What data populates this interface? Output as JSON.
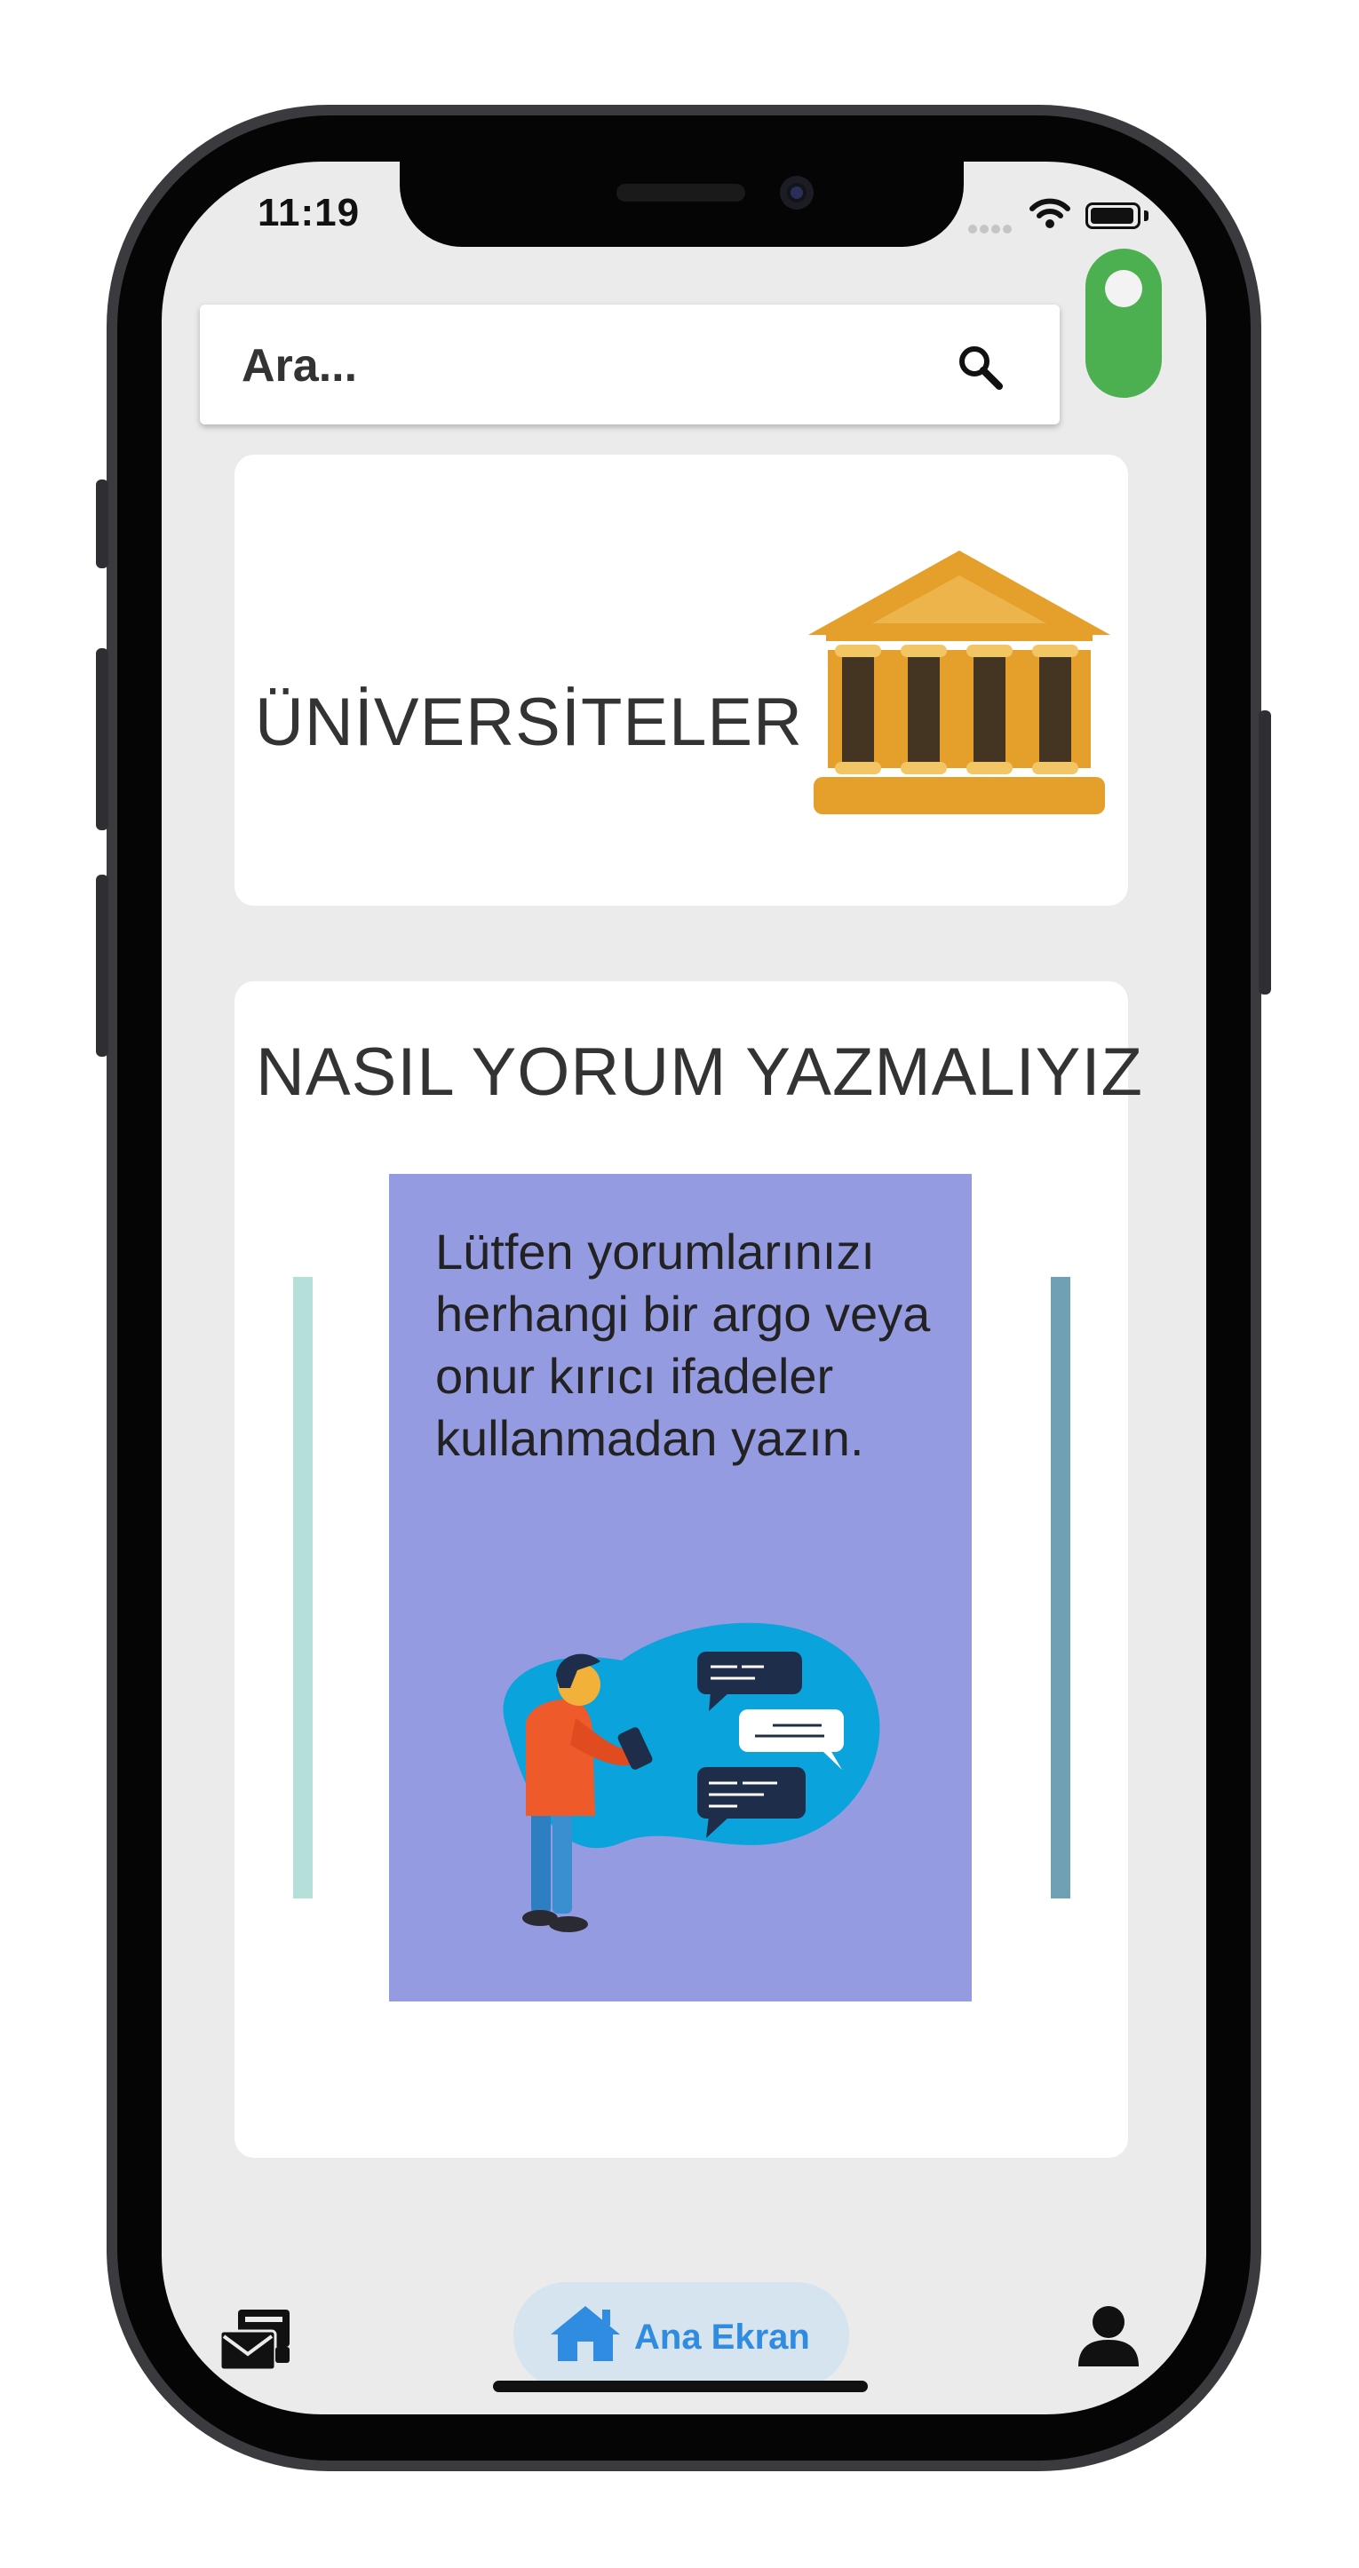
{
  "status_bar": {
    "time": "11:19"
  },
  "search": {
    "placeholder": "Ara..."
  },
  "cards": {
    "universities": {
      "title": "ÜNİVERSİTELER"
    },
    "how_to_comment": {
      "title": "NASIL YORUM YAZMALIYIZ",
      "slide_text": "Lütfen yorumlarınızı herhangi bir argo veya onur kırıcı ifadeler kullanmadan yazın."
    }
  },
  "bottom_nav": {
    "items": [
      {
        "icon": "messages-icon",
        "label": ""
      },
      {
        "icon": "home-icon",
        "label": "Ana Ekran",
        "selected": true
      },
      {
        "icon": "profile-icon",
        "label": ""
      }
    ]
  },
  "colors": {
    "toggle_on": "#4caf50",
    "home_active": "#2f8ce0",
    "museum_gold": "#e4a02b",
    "slide_bg": "#959be0"
  }
}
